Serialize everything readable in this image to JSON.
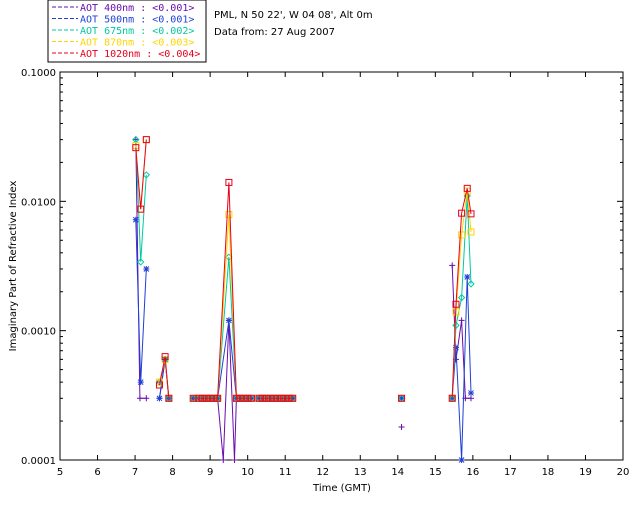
{
  "info": {
    "site": "PML, N 50 22', W 04 08', Alt 0m",
    "date_line": "Data from: 27 Aug 2007"
  },
  "chart_data": {
    "type": "line",
    "xlabel": "Time (GMT)",
    "ylabel": "Imaginary Part of Refractive Index",
    "xlim": [
      5,
      20
    ],
    "ylim": [
      0.0001,
      0.1
    ],
    "y_scale": "log",
    "x_ticks": [
      5,
      6,
      7,
      8,
      9,
      10,
      11,
      12,
      13,
      14,
      15,
      16,
      17,
      18,
      19,
      20
    ],
    "x_tick_labels": [
      "5",
      "6",
      "7",
      "8",
      "9",
      "10",
      "11",
      "12",
      "13",
      "14",
      "15",
      "16",
      "17",
      "18",
      "19",
      "20"
    ],
    "y_ticks": [
      0.0001,
      0.001,
      0.01,
      0.1
    ],
    "y_tick_labels": [
      "0.0001",
      "0.0010",
      "0.0100",
      "0.1000"
    ],
    "grid": false,
    "legend_position": "top-left, outside plot",
    "series": [
      {
        "name": "AOT  400nm : <0.001>",
        "color": "#6a0dad",
        "marker": "plus",
        "segments": [
          [
            [
              7.02,
              0.03
            ],
            [
              7.13,
              0.0003
            ],
            [
              7.3,
              0.0003
            ]
          ],
          [
            [
              7.65,
              0.0003
            ],
            [
              7.8,
              0.0006
            ],
            [
              7.9,
              0.0003
            ]
          ],
          [
            [
              8.55,
              0.0003
            ],
            [
              8.7,
              0.0003
            ],
            [
              8.8,
              0.0003
            ],
            [
              8.9,
              0.0003
            ],
            [
              9.0,
              0.0003
            ],
            [
              9.1,
              0.0003
            ],
            [
              9.2,
              0.0003
            ],
            [
              9.35,
              0.0001
            ],
            [
              9.5,
              0.0012
            ],
            [
              9.65,
              0.0001
            ],
            [
              9.7,
              0.0003
            ],
            [
              9.8,
              0.0003
            ],
            [
              9.9,
              0.0003
            ],
            [
              10.0,
              0.0003
            ],
            [
              10.1,
              0.0003
            ]
          ],
          [
            [
              10.3,
              0.0003
            ],
            [
              10.4,
              0.0003
            ],
            [
              10.5,
              0.0003
            ],
            [
              10.6,
              0.0003
            ],
            [
              10.7,
              0.0003
            ],
            [
              10.8,
              0.0003
            ],
            [
              10.9,
              0.0003
            ],
            [
              11.0,
              0.0003
            ],
            [
              11.1,
              0.0003
            ],
            [
              11.2,
              0.0003
            ]
          ],
          [
            [
              14.1,
              0.00018
            ]
          ],
          [
            [
              15.45,
              0.0032
            ],
            [
              15.55,
              0.0006
            ],
            [
              15.7,
              0.0012
            ],
            [
              15.8,
              0.0003
            ],
            [
              15.95,
              0.0003
            ]
          ]
        ]
      },
      {
        "name": "AOT  500nm : <0.001>",
        "color": "#1f3fd6",
        "marker": "asterisk",
        "segments": [
          [
            [
              7.02,
              0.0072
            ],
            [
              7.15,
              0.0004
            ],
            [
              7.3,
              0.003
            ]
          ],
          [
            [
              7.65,
              0.0003
            ],
            [
              7.8,
              0.0006
            ],
            [
              7.9,
              0.0003
            ]
          ],
          [
            [
              8.55,
              0.0003
            ],
            [
              8.7,
              0.0003
            ],
            [
              8.8,
              0.0003
            ],
            [
              8.9,
              0.0003
            ],
            [
              9.0,
              0.0003
            ],
            [
              9.1,
              0.0003
            ],
            [
              9.2,
              0.0003
            ],
            [
              9.5,
              0.0012
            ],
            [
              9.7,
              0.0003
            ],
            [
              9.8,
              0.0003
            ],
            [
              9.9,
              0.0003
            ],
            [
              10.0,
              0.0003
            ],
            [
              10.1,
              0.0003
            ]
          ],
          [
            [
              10.3,
              0.0003
            ],
            [
              10.4,
              0.0003
            ],
            [
              10.5,
              0.0003
            ],
            [
              10.6,
              0.0003
            ],
            [
              10.7,
              0.0003
            ],
            [
              10.8,
              0.0003
            ],
            [
              10.9,
              0.0003
            ],
            [
              11.0,
              0.0003
            ],
            [
              11.1,
              0.0003
            ],
            [
              11.2,
              0.0003
            ]
          ],
          [
            [
              14.1,
              0.0003
            ]
          ],
          [
            [
              15.45,
              0.0003
            ],
            [
              15.55,
              0.00074
            ],
            [
              15.7,
              0.0001
            ],
            [
              15.85,
              0.0026
            ],
            [
              15.95,
              0.00033
            ]
          ]
        ]
      },
      {
        "name": "AOT  675nm : <0.002>",
        "color": "#00c9a0",
        "marker": "diamond",
        "segments": [
          [
            [
              7.02,
              0.03
            ],
            [
              7.15,
              0.0034
            ],
            [
              7.3,
              0.016
            ]
          ],
          [
            [
              7.65,
              0.0004
            ],
            [
              7.8,
              0.0006
            ],
            [
              7.9,
              0.0003
            ]
          ],
          [
            [
              8.55,
              0.0003
            ],
            [
              8.7,
              0.0003
            ],
            [
              8.8,
              0.0003
            ],
            [
              8.9,
              0.0003
            ],
            [
              9.0,
              0.0003
            ],
            [
              9.1,
              0.0003
            ],
            [
              9.2,
              0.0003
            ],
            [
              9.5,
              0.0037
            ],
            [
              9.7,
              0.0003
            ],
            [
              9.8,
              0.0003
            ],
            [
              9.9,
              0.0003
            ],
            [
              10.0,
              0.0003
            ],
            [
              10.1,
              0.0003
            ]
          ],
          [
            [
              10.3,
              0.0003
            ],
            [
              10.4,
              0.0003
            ],
            [
              10.5,
              0.0003
            ],
            [
              10.6,
              0.0003
            ],
            [
              10.7,
              0.0003
            ],
            [
              10.8,
              0.0003
            ],
            [
              10.9,
              0.0003
            ],
            [
              11.0,
              0.0003
            ],
            [
              11.1,
              0.0003
            ],
            [
              11.2,
              0.0003
            ]
          ],
          [
            [
              14.1,
              0.0003
            ]
          ],
          [
            [
              15.45,
              0.0003
            ],
            [
              15.55,
              0.0011
            ],
            [
              15.7,
              0.0018
            ],
            [
              15.85,
              0.011
            ],
            [
              15.95,
              0.0023
            ]
          ]
        ]
      },
      {
        "name": "AOT  870nm : <0.003>",
        "color": "#ffd400",
        "marker": "square",
        "segments": [
          [
            [
              7.02,
              0.027
            ],
            [
              7.15,
              0.0087
            ],
            [
              7.3,
              0.03
            ]
          ],
          [
            [
              7.65,
              0.0004
            ],
            [
              7.8,
              0.0006
            ],
            [
              7.9,
              0.0003
            ]
          ],
          [
            [
              8.55,
              0.0003
            ],
            [
              8.7,
              0.0003
            ],
            [
              8.8,
              0.0003
            ],
            [
              8.9,
              0.0003
            ],
            [
              9.0,
              0.0003
            ],
            [
              9.1,
              0.0003
            ],
            [
              9.2,
              0.0003
            ],
            [
              9.5,
              0.0079
            ],
            [
              9.7,
              0.0003
            ],
            [
              9.8,
              0.0003
            ],
            [
              9.9,
              0.0003
            ],
            [
              10.0,
              0.0003
            ],
            [
              10.1,
              0.0003
            ]
          ],
          [
            [
              10.3,
              0.0003
            ],
            [
              10.4,
              0.0003
            ],
            [
              10.5,
              0.0003
            ],
            [
              10.6,
              0.0003
            ],
            [
              10.7,
              0.0003
            ],
            [
              10.8,
              0.0003
            ],
            [
              10.9,
              0.0003
            ],
            [
              11.0,
              0.0003
            ],
            [
              11.1,
              0.0003
            ],
            [
              11.2,
              0.0003
            ]
          ],
          [
            [
              14.1,
              0.0003
            ]
          ],
          [
            [
              15.45,
              0.0003
            ],
            [
              15.55,
              0.0014
            ],
            [
              15.7,
              0.0055
            ],
            [
              15.85,
              0.012
            ],
            [
              15.95,
              0.0058
            ]
          ]
        ]
      },
      {
        "name": "AOT 1020nm : <0.004>",
        "color": "#e8001c",
        "marker": "square",
        "segments": [
          [
            [
              7.02,
              0.026
            ],
            [
              7.15,
              0.0087
            ],
            [
              7.3,
              0.03
            ]
          ],
          [
            [
              7.65,
              0.00038
            ],
            [
              7.8,
              0.00063
            ],
            [
              7.9,
              0.0003
            ]
          ],
          [
            [
              8.55,
              0.0003
            ],
            [
              8.7,
              0.0003
            ],
            [
              8.8,
              0.0003
            ],
            [
              8.9,
              0.0003
            ],
            [
              9.0,
              0.0003
            ],
            [
              9.1,
              0.0003
            ],
            [
              9.2,
              0.0003
            ],
            [
              9.5,
              0.014
            ],
            [
              9.7,
              0.0003
            ],
            [
              9.8,
              0.0003
            ],
            [
              9.9,
              0.0003
            ],
            [
              10.0,
              0.0003
            ],
            [
              10.1,
              0.0003
            ]
          ],
          [
            [
              10.3,
              0.0003
            ],
            [
              10.4,
              0.0003
            ],
            [
              10.5,
              0.0003
            ],
            [
              10.6,
              0.0003
            ],
            [
              10.7,
              0.0003
            ],
            [
              10.8,
              0.0003
            ],
            [
              10.9,
              0.0003
            ],
            [
              11.0,
              0.0003
            ],
            [
              11.1,
              0.0003
            ],
            [
              11.2,
              0.0003
            ]
          ],
          [
            [
              14.1,
              0.0003
            ]
          ],
          [
            [
              15.45,
              0.0003
            ],
            [
              15.55,
              0.0016
            ],
            [
              15.7,
              0.0081
            ],
            [
              15.85,
              0.0126
            ],
            [
              15.95,
              0.008
            ]
          ]
        ]
      }
    ]
  }
}
